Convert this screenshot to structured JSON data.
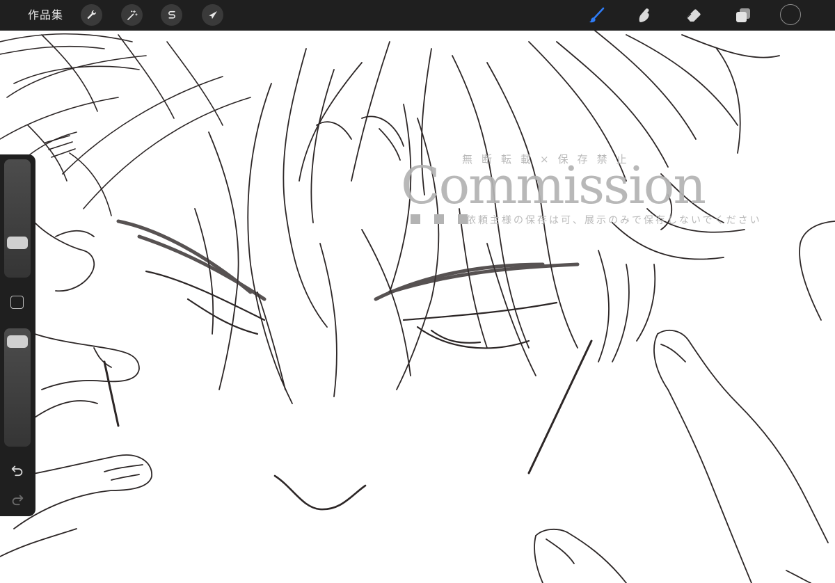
{
  "toolbar": {
    "gallery_label": "作品集",
    "left_tools": [
      {
        "name": "actions",
        "icon": "wrench-icon"
      },
      {
        "name": "adjustments",
        "icon": "magic-wand-icon"
      },
      {
        "name": "selection",
        "icon": "selection-s-icon"
      },
      {
        "name": "transform",
        "icon": "arrow-cursor-icon"
      }
    ],
    "right_tools": [
      {
        "name": "brush",
        "icon": "brush-icon",
        "active": true
      },
      {
        "name": "smudge",
        "icon": "smudge-finger-icon"
      },
      {
        "name": "eraser",
        "icon": "eraser-icon"
      },
      {
        "name": "layers",
        "icon": "layers-icon"
      }
    ],
    "current_color": "#1f1f1f",
    "active_color": "#2f7cf6"
  },
  "watermark": {
    "top_text": "無断転載×保存禁止",
    "main_text": "Commission",
    "bottom_text": "依頼主様の保存は可、展示のみで保存しないでください"
  },
  "sidebar": {
    "size_slider_value": 0.26,
    "opacity_slider_value": 0.96,
    "modify_icon": "square-icon",
    "undo_icon": "undo-icon",
    "redo_icon": "redo-icon"
  }
}
